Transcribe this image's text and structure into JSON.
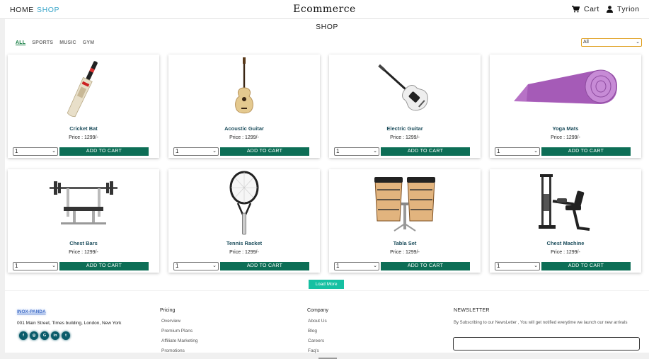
{
  "header": {
    "nav": {
      "home": "HOME",
      "shop": "SHOP"
    },
    "brand": "Ecommerce",
    "cart_label": "Cart",
    "user_name": "Tyrion",
    "icons": {
      "cart": "cart-icon",
      "user": "user-icon"
    }
  },
  "shop": {
    "title": "SHOP",
    "filters": [
      "ALL",
      "SPORTS",
      "MUSIC",
      "GYM"
    ],
    "active_filter": "ALL",
    "category_select": "All",
    "load_more": "Load More",
    "add_to_cart": "ADD TO CART",
    "products": [
      {
        "name": "Cricket Bat",
        "price": "Price : 1299/-",
        "qty": "1",
        "icon": "cricket-bat-icon"
      },
      {
        "name": "Acoustic Guitar",
        "price": "Price : 1299/-",
        "qty": "1",
        "icon": "acoustic-guitar-icon"
      },
      {
        "name": "Electric Guitar",
        "price": "Price : 1299/-",
        "qty": "1",
        "icon": "electric-guitar-icon"
      },
      {
        "name": "Yoga Mats",
        "price": "Price : 1299/-",
        "qty": "1",
        "icon": "yoga-mat-icon"
      },
      {
        "name": "Chest Bars",
        "price": "Price : 1299/-",
        "qty": "1",
        "icon": "bench-press-icon"
      },
      {
        "name": "Tennis Racket",
        "price": "Price : 1299/-",
        "qty": "1",
        "icon": "tennis-racket-icon"
      },
      {
        "name": "Tabla Set",
        "price": "Price : 1299/-",
        "qty": "1",
        "icon": "drums-icon"
      },
      {
        "name": "Chest Machine",
        "price": "Price : 1299/-",
        "qty": "1",
        "icon": "chest-machine-icon"
      }
    ]
  },
  "footer": {
    "brand": "INOX-PANDA",
    "address": "001 Main Street, Times building, London, New York",
    "socials": [
      "facebook-icon",
      "instagram-icon",
      "google-icon",
      "linkedin-icon",
      "twitter-icon"
    ],
    "pricing": {
      "title": "Pricing",
      "links": [
        "Overview",
        "Premium Plans",
        "Affiliate Marketing",
        "Promotions"
      ]
    },
    "company": {
      "title": "Company",
      "links": [
        "About Us",
        "Blog",
        "Careers",
        "Faq's"
      ]
    },
    "newsletter": {
      "title": "NEWSLETTER",
      "text": "By Subscribing to our NewsLetter , You will get notified everytime we launch our new arrivals",
      "placeholder": ""
    }
  },
  "colors": {
    "accent": "#0d6e56",
    "load_more": "#15c0a2",
    "shop_link": "#3aa6c9",
    "filter_active": "#0f7a3e",
    "product_name": "#1c4d5c"
  }
}
